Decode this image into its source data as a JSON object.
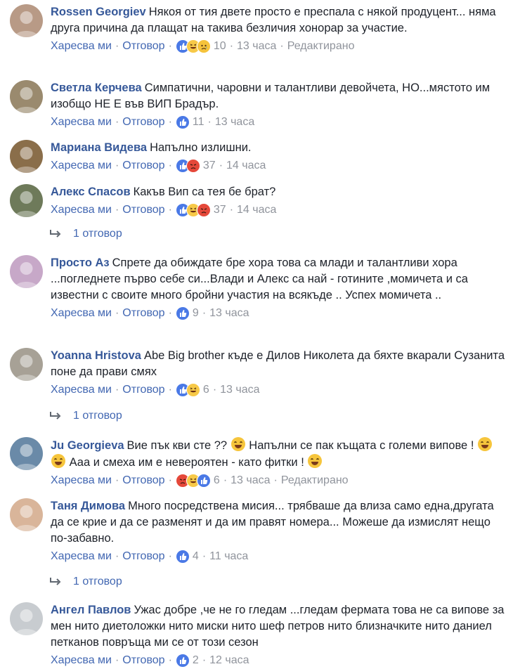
{
  "labels": {
    "like": "Харесва ми",
    "reply": "Отговор",
    "edited": "Редактирано"
  },
  "comments": [
    {
      "author": "Rossen Georgiev",
      "text": "Някоя от тия двете просто е преспала с някой продуцент... няма друга причина да плащат на такива безличия хонорар за участие.",
      "reactions": [
        "like",
        "haha",
        "sad"
      ],
      "count": "10",
      "time": "13 часа",
      "edited": true
    },
    {
      "author": "Светла Керчева",
      "text": "Симпатични, чаровни и талантливи девойчета, НО...мястото им изобщо НЕ Е във ВИП Брадър.",
      "reactions": [
        "like"
      ],
      "count": "11",
      "time": "13 часа",
      "edited": false
    },
    {
      "author": "Мариана Видева",
      "text": "Напълно излишни.",
      "reactions": [
        "like",
        "angry"
      ],
      "count": "37",
      "time": "14 часа",
      "edited": false
    },
    {
      "author": "Алекс Спасов",
      "text": "Какъв Вип са тея бе брат?",
      "reactions": [
        "like",
        "haha",
        "angry"
      ],
      "count": "37",
      "time": "14 часа",
      "edited": false,
      "replies": "1 отговор"
    },
    {
      "author": "Просто Аз",
      "text": "Спрете да обиждате бре хора това са млади и талантливи хора ...погледнете първо себе си...Влади и Алекс са най - готините ,момичета и са известни с своите много бройни участия на всякъде .. Успех момичета ..",
      "reactions": [
        "like"
      ],
      "count": "9",
      "time": "13 часа",
      "edited": false
    },
    {
      "author": "Yoanna Hristova",
      "text": "Abe Big brother къде е Дилов Николета да бяхте вкарали Сузанита поне да прави смях",
      "reactions": [
        "like",
        "haha"
      ],
      "count": "6",
      "time": "13 часа",
      "edited": false,
      "replies": "1 отговор"
    },
    {
      "author": "Ju Georgieva",
      "text_parts": [
        "Вие пък кви сте ?? ",
        " Напълни се пак къщата с големи випове ! ",
        " Ааа и смеха им е невероятен - като фитки ! "
      ],
      "reactions": [
        "angry",
        "haha",
        "like"
      ],
      "count": "6",
      "time": "13 часа",
      "edited": true
    },
    {
      "author": "Таня Димова",
      "text": "Много посредствена мисия... трябваше да влиза само една,другата да се крие и да се разменят и да им правят номера... Можеше да измислят нещо по-забавно.",
      "reactions": [
        "like"
      ],
      "count": "4",
      "time": "11 часа",
      "edited": false,
      "replies": "1 отговор"
    },
    {
      "author": "Ангел Павлов",
      "text": "Ужас добре ,че не го гледам ...гледам фермата това не са випове за мен нито диетоложки нито миски нито шеф петров нито близначките нито даниел петканов повръща ми се от този сезон",
      "reactions": [
        "like"
      ],
      "count": "2",
      "time": "12 часа",
      "edited": false
    }
  ],
  "colors": {
    "author": "#365899",
    "link": "#4267b2",
    "meta": "#90949c",
    "like": "#4a79e6",
    "haha": "#f7c948",
    "angry": "#e5483a"
  }
}
